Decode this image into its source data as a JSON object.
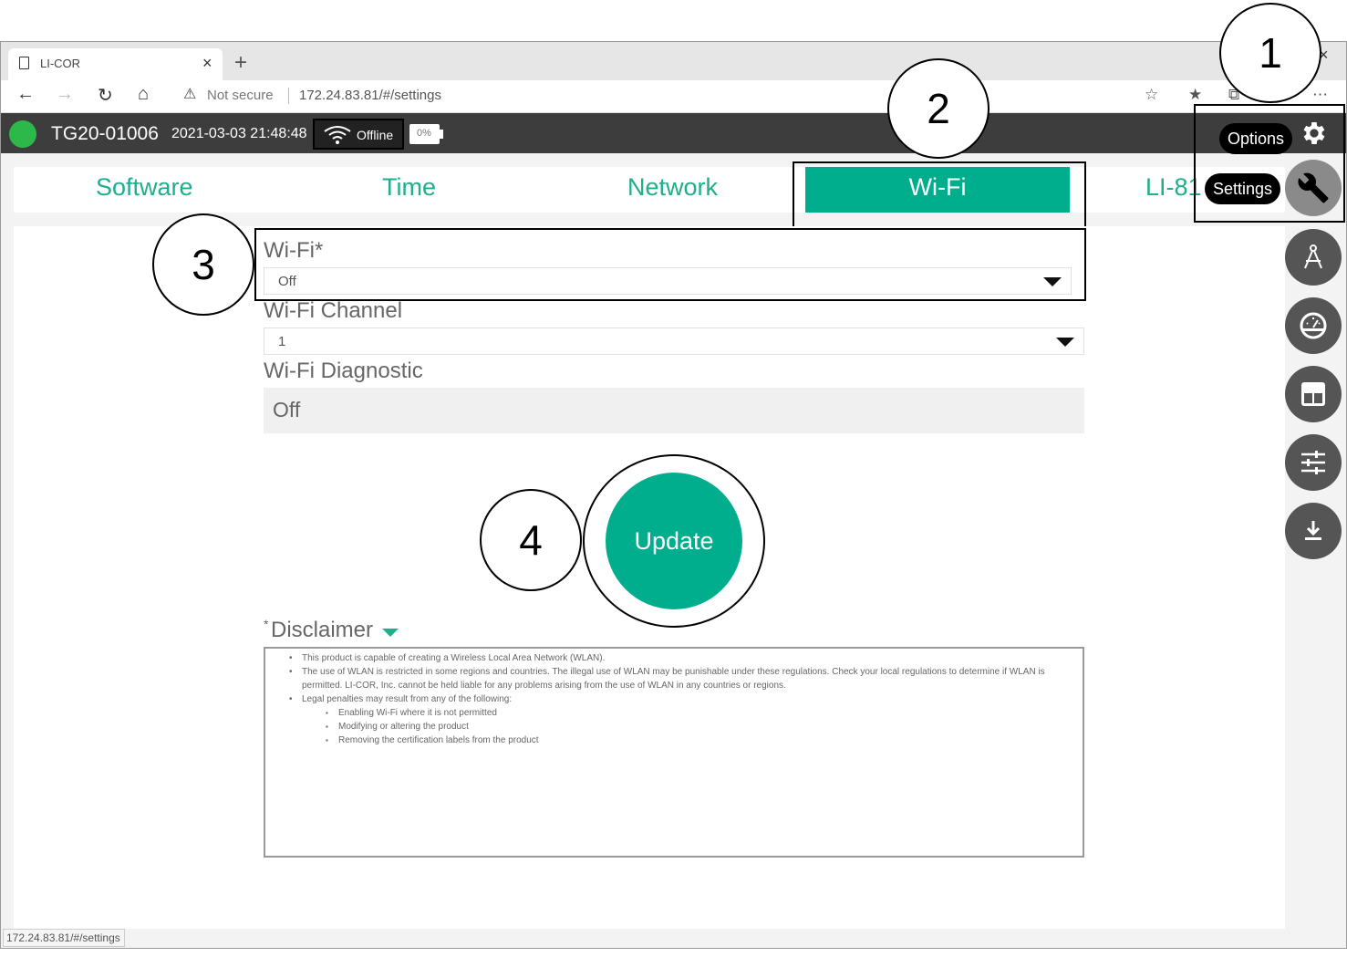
{
  "browser": {
    "tab_title": "LI-COR",
    "tab_close": "×",
    "new_tab": "+",
    "not_secure": "Not secure",
    "url": "172.24.83.81/#/settings",
    "status_url": "172.24.83.81/#/settings"
  },
  "header": {
    "device_id": "TG20-01006",
    "datetime": "2021-03-03 21:48:48",
    "connection": "Offline",
    "battery": "0%",
    "status_color": "#2db84a"
  },
  "tabs": [
    "Software",
    "Time",
    "Network",
    "Wi-Fi",
    "LI-81"
  ],
  "active_tab": "Wi-Fi",
  "form": {
    "wifi_label": "Wi-Fi*",
    "wifi_value": "Off",
    "channel_label": "Wi-Fi Channel",
    "channel_value": "1",
    "diag_label": "Wi-Fi Diagnostic",
    "diag_value": "Off",
    "update_label": "Update"
  },
  "disclaimer": {
    "star": "*",
    "title": "Disclaimer",
    "items": [
      "This product is capable of creating a Wireless Local Area Network (WLAN).",
      "The use of WLAN is restricted in some regions and countries. The illegal use of WLAN may be punishable under these regulations. Check your local regulations to determine if WLAN is permitted. LI-COR, Inc. cannot be held liable for any problems arising from the use of WLAN in any countries or regions.",
      "Legal penalties may result from any of the following:"
    ],
    "subitems": [
      "Enabling Wi-Fi where it is not permitted",
      "Modifying or altering the product",
      "Removing the certification labels from the product"
    ]
  },
  "side": {
    "options_label": "Options",
    "settings_label": "Settings"
  },
  "callouts": [
    "1",
    "2",
    "3",
    "4"
  ],
  "accent": "#00ae8e"
}
